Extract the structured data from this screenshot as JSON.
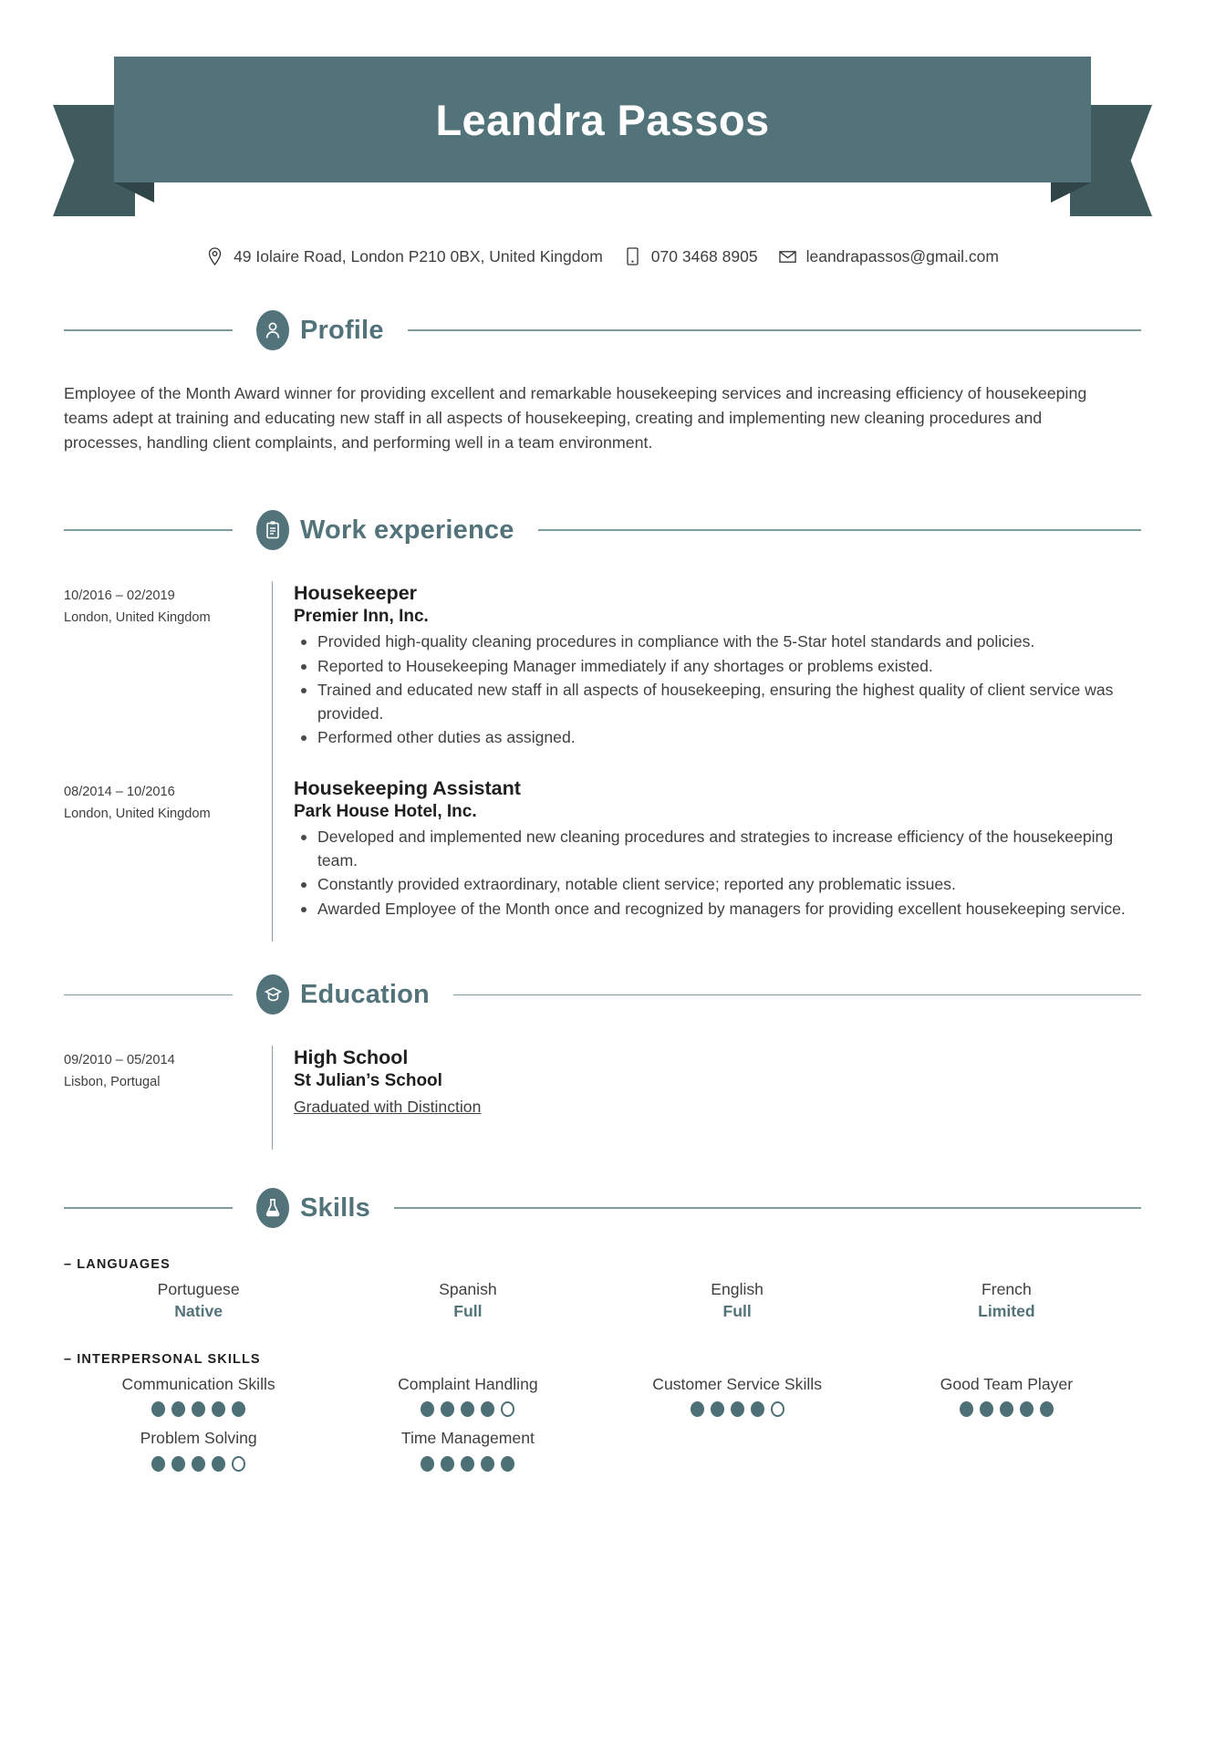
{
  "header": {
    "name": "Leandra Passos",
    "banner_color": "#52737a",
    "banner_fold_color": "#3f5b5e"
  },
  "contact": {
    "address": "49 Iolaire Road, London P210 0BX, United Kingdom",
    "phone": "070 3468 8905",
    "email": "leandrapassos@gmail.com",
    "icons": {
      "address": "location-pin-icon",
      "phone": "mobile-phone-icon",
      "email": "envelope-icon"
    }
  },
  "sections": {
    "profile": {
      "title": "Profile",
      "icon": "person-icon",
      "text": "Employee of the Month Award winner for providing excellent and remarkable housekeeping services and increasing efficiency of housekeeping teams adept at training and educating new staff in all aspects of housekeeping, creating and implementing new cleaning procedures and processes, handling client complaints, and performing well in a team environment."
    },
    "work": {
      "title": "Work experience",
      "icon": "clipboard-icon",
      "entries": [
        {
          "dates": "10/2016 – 02/2019",
          "location": "London, United Kingdom",
          "title": "Housekeeper",
          "company": "Premier Inn, Inc.",
          "bullets": [
            "Provided high-quality cleaning procedures in compliance with the 5-Star hotel standards and policies.",
            "Reported to Housekeeping Manager immediately if any shortages or problems existed.",
            "Trained and educated new staff in all aspects of housekeeping, ensuring the highest quality of client service was provided.",
            "Performed other duties as assigned."
          ]
        },
        {
          "dates": "08/2014 – 10/2016",
          "location": "London, United Kingdom",
          "title": "Housekeeping Assistant",
          "company": "Park House Hotel, Inc.",
          "bullets": [
            "Developed and implemented new cleaning procedures and strategies to increase efficiency of the housekeeping team.",
            "Constantly provided extraordinary, notable client service; reported any problematic issues.",
            "Awarded Employee of the Month once and recognized by managers for providing excellent housekeeping service."
          ]
        }
      ]
    },
    "education": {
      "title": "Education",
      "icon": "graduation-cap-icon",
      "entries": [
        {
          "dates": "09/2010 – 05/2014",
          "location": "Lisbon, Portugal",
          "title": "High School",
          "company": "St Julian’s School",
          "note": "Graduated with Distinction"
        }
      ]
    },
    "skills": {
      "title": "Skills",
      "icon": "flask-icon",
      "languages": {
        "label": "– LANGUAGES",
        "items": [
          {
            "name": "Portuguese",
            "level": "Native"
          },
          {
            "name": "Spanish",
            "level": "Full"
          },
          {
            "name": "English",
            "level": "Full"
          },
          {
            "name": "French",
            "level": "Limited"
          }
        ]
      },
      "interpersonal": {
        "label": "– INTERPERSONAL SKILLS",
        "max_dots": 5,
        "items": [
          {
            "name": "Communication Skills",
            "rating": 5
          },
          {
            "name": "Complaint Handling",
            "rating": 4
          },
          {
            "name": "Customer Service Skills",
            "rating": 4
          },
          {
            "name": "Good Team Player",
            "rating": 5
          },
          {
            "name": "Problem Solving",
            "rating": 4
          },
          {
            "name": "Time Management",
            "rating": 5
          }
        ]
      }
    }
  }
}
